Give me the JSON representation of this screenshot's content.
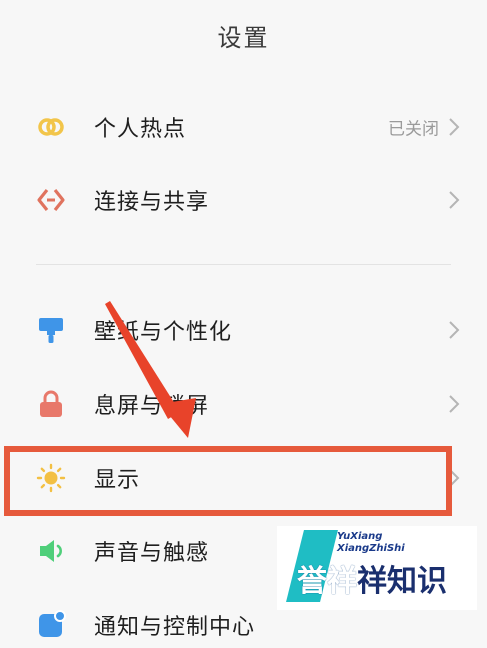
{
  "header": {
    "title": "设置"
  },
  "sections": {
    "network": [
      {
        "id": "hotspot",
        "label": "个人热点",
        "value": "已关闭",
        "icon": "hotspot-icon"
      },
      {
        "id": "connection",
        "label": "连接与共享",
        "value": "",
        "icon": "connection-share-icon"
      }
    ],
    "personal": [
      {
        "id": "wallpaper",
        "label": "壁纸与个性化",
        "icon": "wallpaper-brush-icon"
      },
      {
        "id": "lockscreen",
        "label": "息屏与锁屏",
        "icon": "lock-icon"
      },
      {
        "id": "display",
        "label": "显示",
        "icon": "sun-icon"
      },
      {
        "id": "sound",
        "label": "声音与触感",
        "icon": "speaker-icon"
      },
      {
        "id": "notification",
        "label": "通知与控制中心",
        "icon": "notification-icon"
      }
    ]
  },
  "watermark": {
    "line1": "YuXiang",
    "line2": "XiangZhiShi",
    "main_a": "誉",
    "main_b": "祥",
    "main_c": "祥知识"
  },
  "colors": {
    "highlight": "#e65a3c",
    "arrow": "#e8432a",
    "hotspot": "#f2c54a",
    "connection": "#e0735e",
    "wallpaper": "#3f95e8",
    "lock": "#e8786a",
    "display": "#f3c043",
    "sound": "#4fcf7a",
    "notification": "#3f95e8",
    "watermark_accent": "#1fbdc4"
  }
}
